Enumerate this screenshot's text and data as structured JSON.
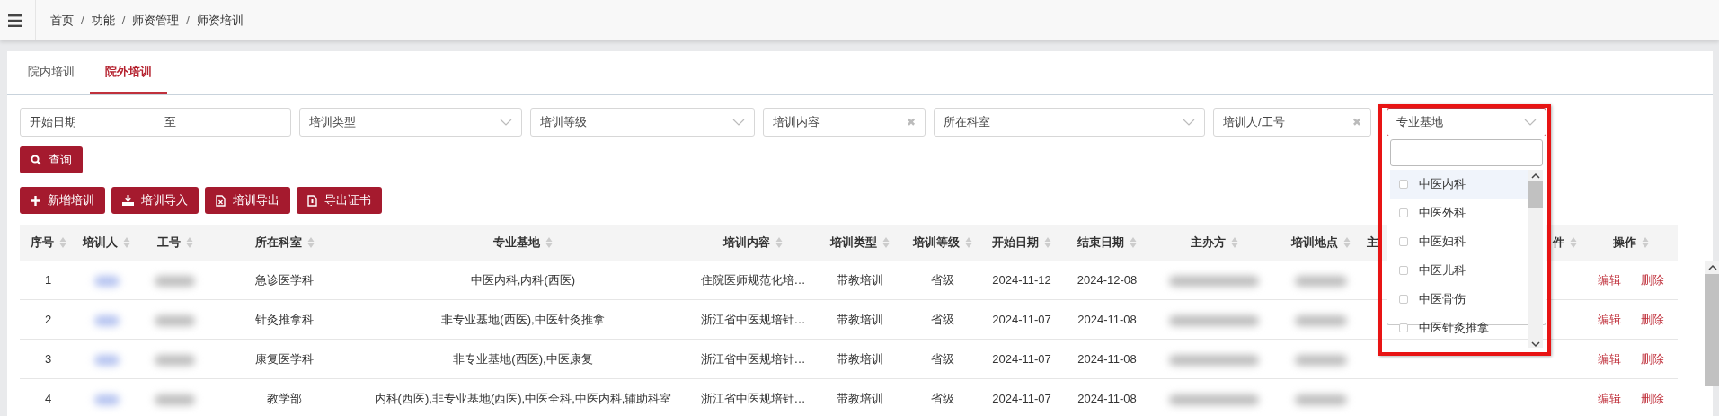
{
  "breadcrumb": {
    "separator": "/",
    "items": [
      "首页",
      "功能",
      "师资管理",
      "师资培训"
    ]
  },
  "tabs": [
    {
      "label": "院内培训",
      "selected": false
    },
    {
      "label": "院外培训",
      "selected": true
    }
  ],
  "filters": [
    {
      "kind": "daterange",
      "placeholder": "开始日期",
      "connector": "至"
    },
    {
      "kind": "select",
      "placeholder": "培训类型"
    },
    {
      "kind": "select",
      "placeholder": "培训等级"
    },
    {
      "kind": "clearable",
      "placeholder": "培训内容",
      "clear": "✖"
    },
    {
      "kind": "select",
      "placeholder": "所在科室"
    },
    {
      "kind": "clearable",
      "placeholder": "培训人/工号",
      "clear": "✖"
    },
    {
      "kind": "open",
      "placeholder": "专业基地"
    }
  ],
  "dropdown": {
    "items": [
      {
        "label": "中医内科",
        "checked": false,
        "highlighted": true
      },
      {
        "label": "中医外科",
        "checked": false,
        "highlighted": false
      },
      {
        "label": "中医妇科",
        "checked": false,
        "highlighted": false
      },
      {
        "label": "中医儿科",
        "checked": false,
        "highlighted": false
      },
      {
        "label": "中医骨伤",
        "checked": false,
        "highlighted": false
      },
      {
        "label": "中医针灸推拿",
        "checked": false,
        "highlighted": false
      }
    ]
  },
  "query_button": {
    "label": "查询"
  },
  "actions": [
    {
      "kind": "plus",
      "label": "新增培训"
    },
    {
      "kind": "download",
      "label": "培训导入"
    },
    {
      "kind": "excel",
      "label": "培训导出"
    },
    {
      "kind": "file",
      "label": "导出证书"
    }
  ],
  "table": {
    "columns": [
      {
        "label": "序号",
        "kind": "text",
        "sortable": true
      },
      {
        "label": "培训人",
        "kind": "link-redacted",
        "sortable": true
      },
      {
        "label": "工号",
        "kind": "redacted",
        "sortable": true
      },
      {
        "label": "所在科室",
        "kind": "text",
        "sortable": true
      },
      {
        "label": "专业基地",
        "kind": "text",
        "sortable": true
      },
      {
        "label": "培训内容",
        "kind": "text",
        "sortable": true
      },
      {
        "label": "培训类型",
        "kind": "text",
        "sortable": true
      },
      {
        "label": "培训等级",
        "kind": "text",
        "sortable": true
      },
      {
        "label": "开始日期",
        "kind": "text",
        "sortable": true
      },
      {
        "label": "结束日期",
        "kind": "text",
        "sortable": true
      },
      {
        "label": "主办方",
        "kind": "redacted",
        "sortable": true
      },
      {
        "label": "培训地点",
        "kind": "redacted",
        "sortable": true
      },
      {
        "label": "主",
        "kind": "empty",
        "sortable": false
      },
      {
        "label": "件",
        "kind": "empty",
        "sortable": true
      },
      {
        "label": "操作",
        "kind": "actions",
        "sortable": true
      }
    ],
    "rows": [
      {
        "cells": [
          "1",
          "",
          "",
          "急诊医学科",
          "中医内科,内科(西医)",
          "住院医师规范化培…",
          "带教培训",
          "省级",
          "2024-11-12",
          "2024-12-08",
          "",
          "",
          "",
          "",
          ""
        ],
        "actions": [
          "编辑",
          "删除"
        ]
      },
      {
        "cells": [
          "2",
          "",
          "",
          "针灸推拿科",
          "非专业基地(西医),中医针灸推拿",
          "浙江省中医规培针…",
          "带教培训",
          "省级",
          "2024-11-07",
          "2024-11-08",
          "",
          "",
          "",
          "",
          ""
        ],
        "actions": [
          "编辑",
          "删除"
        ]
      },
      {
        "cells": [
          "3",
          "",
          "",
          "康复医学科",
          "非专业基地(西医),中医康复",
          "浙江省中医规培针…",
          "带教培训",
          "省级",
          "2024-11-07",
          "2024-11-08",
          "",
          "",
          "",
          "",
          ""
        ],
        "actions": [
          "编辑",
          "删除"
        ]
      },
      {
        "cells": [
          "4",
          "",
          "",
          "教学部",
          "内科(西医),非专业基地(西医),中医全科,中医内科,辅助科室",
          "浙江省中医规培针…",
          "带教培训",
          "省级",
          "2024-11-07",
          "2024-11-08",
          "",
          "",
          "",
          "",
          ""
        ],
        "actions": [
          "编辑",
          "删除"
        ]
      }
    ]
  }
}
